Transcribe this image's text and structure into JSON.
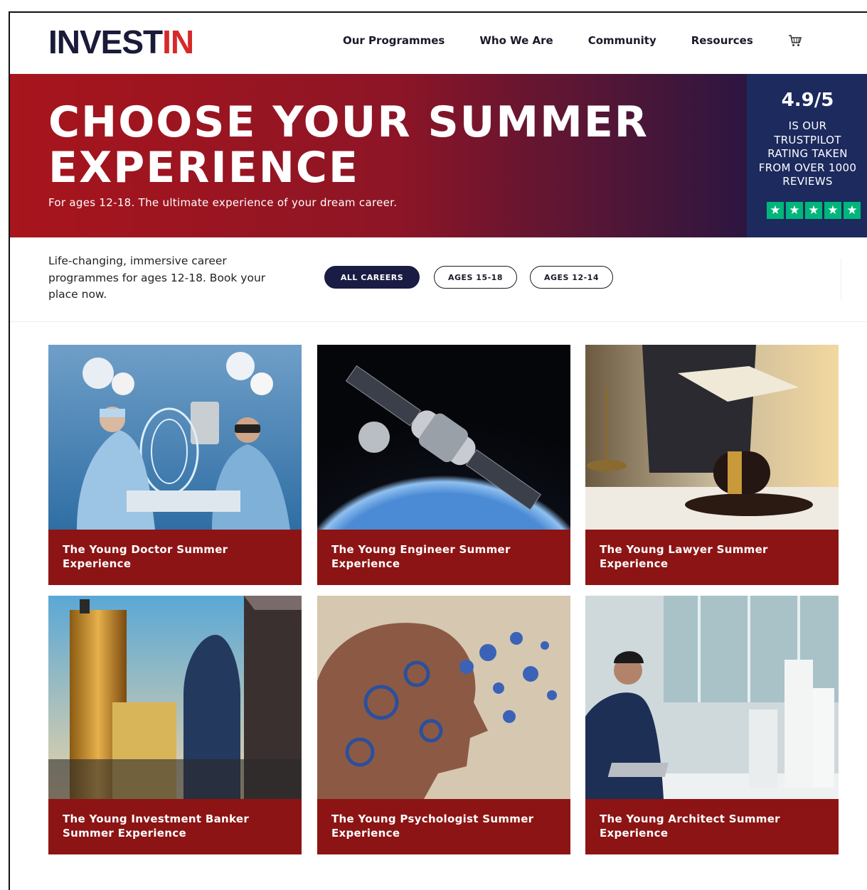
{
  "brand": {
    "logo_part1": "INVEST",
    "logo_part2": "IN"
  },
  "nav": {
    "items": [
      "Our Programmes",
      "Who We Are",
      "Community",
      "Resources"
    ],
    "cart_icon": "cart-icon"
  },
  "hero": {
    "title": "CHOOSE YOUR SUMMER EXPERIENCE",
    "subtitle": "For ages 12-18. The ultimate experience of your dream career.",
    "rating": {
      "score": "4.9/5",
      "text": "IS OUR\nTRUSTPILOT\nRATING TAKEN\nFROM OVER 1000\nREVIEWS",
      "stars": 5
    }
  },
  "filter": {
    "description": "Life-changing, immersive career programmes for ages 12-18. Book your place now.",
    "options": [
      "ALL CAREERS",
      "AGES 15-18",
      "AGES 12-14"
    ],
    "selected": "ALL CAREERS"
  },
  "cards": [
    {
      "title": "The Young Doctor Summer Experience",
      "image": "surgeons-vr-operating-room"
    },
    {
      "title": "The Young Engineer Summer Experience",
      "image": "satellite-over-earth"
    },
    {
      "title": "The Young Lawyer Summer Experience",
      "image": "gavel-scales-book"
    },
    {
      "title": "The Young Investment Banker Summer Experience",
      "image": "city-skyscrapers"
    },
    {
      "title": "The Young Psychologist Summer Experience",
      "image": "head-of-gears"
    },
    {
      "title": "The Young Architect Summer Experience",
      "image": "architect-with-laptop"
    }
  ],
  "colors": {
    "brand_red": "#d62a2a",
    "brand_navy": "#1a1a3a",
    "caption_red": "#8c1414",
    "rating_bg": "#1c2a5e",
    "trustpilot_green": "#00b67a"
  }
}
